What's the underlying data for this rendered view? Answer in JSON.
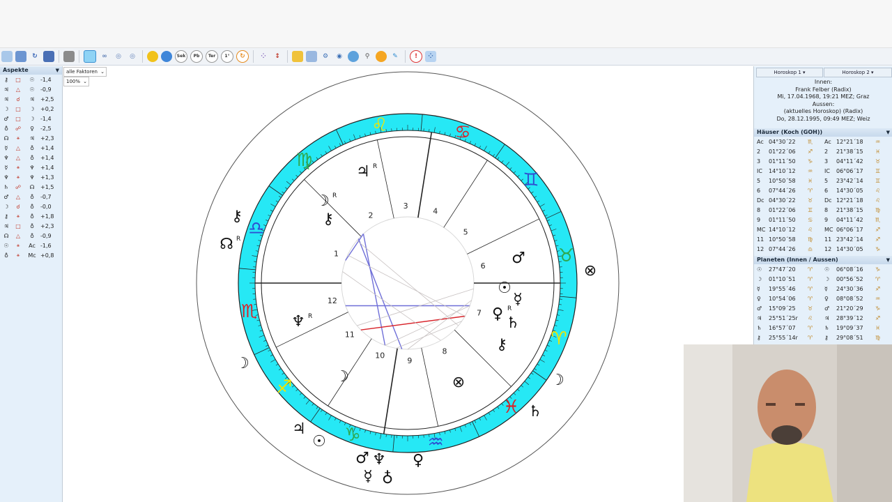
{
  "toolbar": {
    "icons": [
      "new-icon",
      "open-icon",
      "redo-icon",
      "save-icon",
      "print-icon",
      "radix-icon",
      "synastry-icon",
      "composite-icon",
      "combine-icon",
      "sun-icon",
      "moon-icon",
      "sek-icon",
      "pb-icon",
      "ter-icon",
      "one-degree-icon",
      "refresh-icon",
      "midpoints-icon",
      "transit-icon",
      "calendar-icon",
      "aspects-icon",
      "search-icon",
      "globe-icon",
      "zoom-icon",
      "paint-icon",
      "edit-icon",
      "info-icon",
      "settings-icon"
    ],
    "labels": {
      "sek": "Sek",
      "pb": "Pb",
      "ter": "Ter",
      "one": "1°"
    }
  },
  "left_panel": {
    "title": "Aspekte",
    "factors_select": "alle Faktoren",
    "zoom_select": "100%",
    "rows": [
      {
        "p1": "⚷",
        "aspect": "□",
        "p2": "☉",
        "orb": "-1,4"
      },
      {
        "p1": "♃",
        "aspect": "△",
        "p2": "☉",
        "orb": "-0,9"
      },
      {
        "p1": "♃",
        "aspect": "☌",
        "p2": "♃",
        "orb": "+2,5"
      },
      {
        "p1": "☽",
        "aspect": "□",
        "p2": "☽",
        "orb": "+0,2"
      },
      {
        "p1": "♂",
        "aspect": "□",
        "p2": "☽",
        "orb": "-1,4"
      },
      {
        "p1": "♁",
        "aspect": "☍",
        "p2": "♀",
        "orb": "-2,5"
      },
      {
        "p1": "☊",
        "aspect": "⚹",
        "p2": "♃",
        "orb": "+2,3"
      },
      {
        "p1": "☿",
        "aspect": "△",
        "p2": "♁",
        "orb": "+1,4"
      },
      {
        "p1": "♆",
        "aspect": "△",
        "p2": "♁",
        "orb": "+1,4"
      },
      {
        "p1": "☿",
        "aspect": "⚹",
        "p2": "♆",
        "orb": "+1,4"
      },
      {
        "p1": "♆",
        "aspect": "⚹",
        "p2": "♆",
        "orb": "+1,3"
      },
      {
        "p1": "♄",
        "aspect": "☍",
        "p2": "☊",
        "orb": "+1,5"
      },
      {
        "p1": "♂",
        "aspect": "△",
        "p2": "♁",
        "orb": "-0,7"
      },
      {
        "p1": "☽",
        "aspect": "☌",
        "p2": "♁",
        "orb": "-0,0"
      },
      {
        "p1": "⚷",
        "aspect": "⚹",
        "p2": "♁",
        "orb": "+1,8"
      },
      {
        "p1": "♃",
        "aspect": "□",
        "p2": "♁",
        "orb": "+2,3"
      },
      {
        "p1": "☊",
        "aspect": "△",
        "p2": "♁",
        "orb": "-0,9"
      },
      {
        "p1": "☉",
        "aspect": "⚹",
        "p2": "Ac",
        "orb": "-1,6"
      },
      {
        "p1": "♁",
        "aspect": "⚹",
        "p2": "Mc",
        "orb": "+0,8"
      }
    ]
  },
  "right_panel": {
    "tab1": "Horoskop 1",
    "tab2": "Horoskop 2",
    "info": [
      "Innen:",
      "Frank Felber (Radix)",
      "Mi, 17.04.1968, 19:21 MEZ; Graz",
      "Aussen:",
      "(aktuelles Horoskop) (Radix)",
      "Do, 28.12.1995, 09:49 MEZ; Weiz"
    ],
    "houses_title": "Häuser (Koch (GOH))",
    "houses": [
      {
        "h1": "Ac",
        "d1": "04°30´22",
        "s1": "♏",
        "h2": "Ac",
        "d2": "12°21´18",
        "s2": "♒"
      },
      {
        "h1": "2",
        "d1": "01°22´06",
        "s1": "♐",
        "h2": "2",
        "d2": "21°38´15",
        "s2": "♓"
      },
      {
        "h1": "3",
        "d1": "01°11´50",
        "s1": "♑",
        "h2": "3",
        "d2": "04°11´42",
        "s2": "♉"
      },
      {
        "h1": "IC",
        "d1": "14°10´12",
        "s1": "♒",
        "h2": "IC",
        "d2": "06°06´17",
        "s2": "♊"
      },
      {
        "h1": "5",
        "d1": "10°50´58",
        "s1": "♓",
        "h2": "5",
        "d2": "23°42´14",
        "s2": "♊"
      },
      {
        "h1": "6",
        "d1": "07°44´26",
        "s1": "♈",
        "h2": "6",
        "d2": "14°30´05",
        "s2": "♌"
      },
      {
        "h1": "Dc",
        "d1": "04°30´22",
        "s1": "♉",
        "h2": "Dc",
        "d2": "12°21´18",
        "s2": "♌"
      },
      {
        "h1": "8",
        "d1": "01°22´06",
        "s1": "♊",
        "h2": "8",
        "d2": "21°38´15",
        "s2": "♍"
      },
      {
        "h1": "9",
        "d1": "01°11´50",
        "s1": "♋",
        "h2": "9",
        "d2": "04°11´42",
        "s2": "♏"
      },
      {
        "h1": "MC",
        "d1": "14°10´12",
        "s1": "♌",
        "h2": "MC",
        "d2": "06°06´17",
        "s2": "♐"
      },
      {
        "h1": "11",
        "d1": "10°50´58",
        "s1": "♍",
        "h2": "11",
        "d2": "23°42´14",
        "s2": "♐"
      },
      {
        "h1": "12",
        "d1": "07°44´26",
        "s1": "♎",
        "h2": "12",
        "d2": "14°30´05",
        "s2": "♑"
      }
    ],
    "planets_title": "Planeten (Innen / Aussen)",
    "planets": [
      {
        "p1": "☉",
        "d1": "27°47´20",
        "s1": "♈",
        "p2": "☉",
        "d2": "06°08´16",
        "s2": "♑"
      },
      {
        "p1": "☽",
        "d1": "01°10´51",
        "s1": "♈",
        "p2": "☽",
        "d2": "00°56´52",
        "s2": "♈"
      },
      {
        "p1": "☿",
        "d1": "19°55´46",
        "s1": "♈",
        "p2": "☿",
        "d2": "24°30´36",
        "s2": "♐"
      },
      {
        "p1": "♀",
        "d1": "10°54´06",
        "s1": "♈",
        "p2": "♀",
        "d2": "08°08´52",
        "s2": "♒"
      },
      {
        "p1": "♂",
        "d1": "15°09´25",
        "s1": "♉",
        "p2": "♂",
        "d2": "21°20´29",
        "s2": "♑"
      },
      {
        "p1": "♃",
        "d1": "25°51´25r",
        "s1": "♌",
        "p2": "♃",
        "d2": "28°39´12",
        "s2": "♐"
      },
      {
        "p1": "♄",
        "d1": "16°57´07",
        "s1": "♈",
        "p2": "♄",
        "d2": "19°09´37",
        "s2": "♓"
      },
      {
        "p1": "⚷",
        "d1": "25°55´14r",
        "s1": "♈",
        "p2": "⚷",
        "d2": "29°08´51",
        "s2": "♍"
      }
    ]
  },
  "chart": {
    "zodiac": [
      "♈",
      "♉",
      "♊",
      "♋",
      "♌",
      "♍",
      "♎",
      "♏",
      "♐",
      "♑",
      "♒",
      "♓"
    ],
    "house_numbers": [
      "1",
      "2",
      "3",
      "4",
      "5",
      "6",
      "7",
      "8",
      "9",
      "10",
      "11",
      "12"
    ],
    "retrograde_marker": "R",
    "colors": {
      "ring": "#26e8f5",
      "aspect_blue": "#6f6fd8",
      "aspect_red": "#d8232a",
      "aspect_grey": "#c8c2c2"
    }
  }
}
